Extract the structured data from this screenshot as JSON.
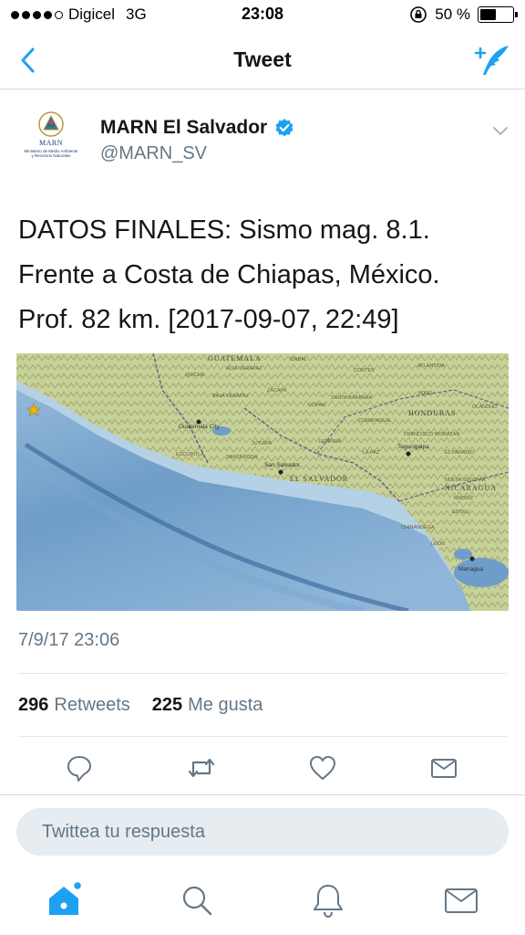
{
  "status_bar": {
    "carrier": "Digicel",
    "network": "3G",
    "time": "23:08",
    "battery": "50 %",
    "battery_level": 0.5
  },
  "nav": {
    "title": "Tweet",
    "back_icon": "chevron-left-icon",
    "compose_icon": "compose-tweet-icon"
  },
  "tweet": {
    "display_name": "MARN El Salvador",
    "handle": "@MARN_SV",
    "verified": true,
    "avatar": {
      "label": "MARN",
      "subtitle": "Ministerio de Medio Ambiente y Recursos Naturales"
    },
    "text_lines": [
      "DATOS FINALES: Sismo mag. 8.1.",
      "Frente a Costa de Chiapas, México.",
      "Prof. 82 km. [2017-09-07, 22:49]"
    ],
    "timestamp": "7/9/17 23:06",
    "retweets_count": "296",
    "retweets_label": "Retweets",
    "likes_count": "225",
    "likes_label": "Me gusta"
  },
  "map": {
    "labels": {
      "guatemala": "GUATEMALA",
      "el_salvador": "EL SALVADOR",
      "honduras": "HONDURAS",
      "nicaragua": "NICARAGUA",
      "san_salvador": "San Salvador",
      "guatemala_city": "Guatemala City",
      "tegucigalpa": "Tegucigalpa",
      "managua": "Managua",
      "leon": "LEON",
      "chinandega": "CHINANDEGA",
      "jutiapa": "JUTIAPA",
      "santa_rosa": "SANTA ROSA",
      "escuintla": "ESCUINTLA",
      "la_paz": "LA PAZ",
      "olancho": "OLANCHO",
      "el_paraiso": "EL PARAISO",
      "atlantida": "ATLANTIDA",
      "madriz": "MADRIZ",
      "esteli": "ESTELI",
      "nueva_segovia": "NUEVA SEGOVIA",
      "alta_verapaz": "ALTA VERAPAZ",
      "baja_verapaz": "BAJA VERAPAZ",
      "quiche": "QUICHE",
      "izabal": "IZABAL",
      "zacapa": "ZACAPA",
      "copan": "COPAN",
      "santa_barbara": "SANTA BARBARA",
      "lempira": "LEMPIRA",
      "francisco_morazan": "FRANCISCO MORAZAN",
      "comayagua": "COMAYAGUA",
      "yoro": "YORO",
      "cortes": "CORTES"
    },
    "colors": {
      "ocean_deep": "#5e8fc0",
      "ocean_shallow": "#a8c8e0",
      "land": "#c6d39a",
      "mountains": "#a9a86f"
    }
  },
  "actions": {
    "reply_icon": "reply-icon",
    "retweet_icon": "retweet-icon",
    "like_icon": "heart-icon",
    "dm_icon": "envelope-icon"
  },
  "reply": {
    "placeholder": "Twittea tu respuesta"
  },
  "tabs": {
    "home_icon": "home-icon",
    "search_icon": "search-icon",
    "notifications_icon": "bell-icon",
    "messages_icon": "envelope-icon"
  },
  "colors": {
    "accent": "#1da1f2",
    "text": "#14171a",
    "secondary_text": "#657786",
    "icon_gray": "#657786"
  }
}
